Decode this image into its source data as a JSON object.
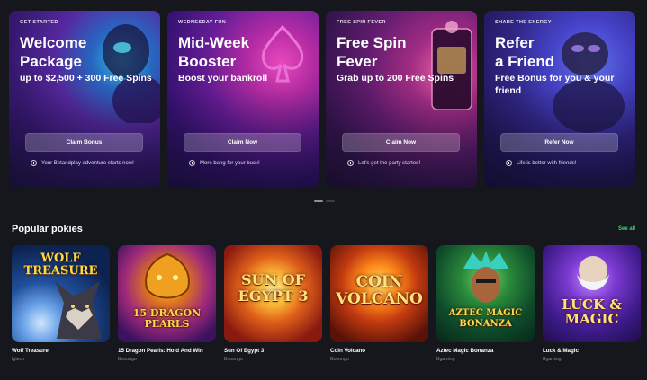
{
  "promos": [
    {
      "tag": "GET STARTED",
      "title": "Welcome\nPackage",
      "subtitle": "up to $2,500 + 300 Free Spins",
      "button": "Claim Bonus",
      "note": "Your Betandplay adventure starts now!"
    },
    {
      "tag": "WEDNESDAY FUN",
      "title": "Mid-Week\nBooster",
      "subtitle": "Boost your bankroll",
      "button": "Claim Now",
      "note": "More bang for your buck!"
    },
    {
      "tag": "FREE SPIN FEVER",
      "title": "Free Spin\nFever",
      "subtitle": "Grab up to 200 Free Spins",
      "button": "Claim Now",
      "note": "Let's get the party started!"
    },
    {
      "tag": "SHARE THE ENERGY",
      "title": "Refer\na Friend",
      "subtitle": "Free Bonus for you & your friend",
      "button": "Refer Now",
      "note": "Life is better with friends!"
    }
  ],
  "section": {
    "title": "Popular pokies",
    "see_all": "See all"
  },
  "games": [
    {
      "name": "Wolf Treasure",
      "provider": "Igtech",
      "logo": "WOLF TREASURE"
    },
    {
      "name": "15 Dragon Pearls: Hold And Win",
      "provider": "Booongo",
      "logo": "15 DRAGON PEARLS"
    },
    {
      "name": "Sun Of Egypt 3",
      "provider": "Booongo",
      "logo": "SUN OF EGYPT 3"
    },
    {
      "name": "Coin Volcano",
      "provider": "Booongo",
      "logo": "COIN VOLCANO"
    },
    {
      "name": "Aztec Magic Bonanza",
      "provider": "Bgaming",
      "logo": "AZTEC MAGIC BONANZA"
    },
    {
      "name": "Luck & Magic",
      "provider": "Bgaming",
      "logo": "LUCK & MAGIC"
    }
  ],
  "carousel": {
    "pages": 2,
    "active": 0
  },
  "colors": {
    "background": "#15171c",
    "accent_green": "#3fd277"
  }
}
